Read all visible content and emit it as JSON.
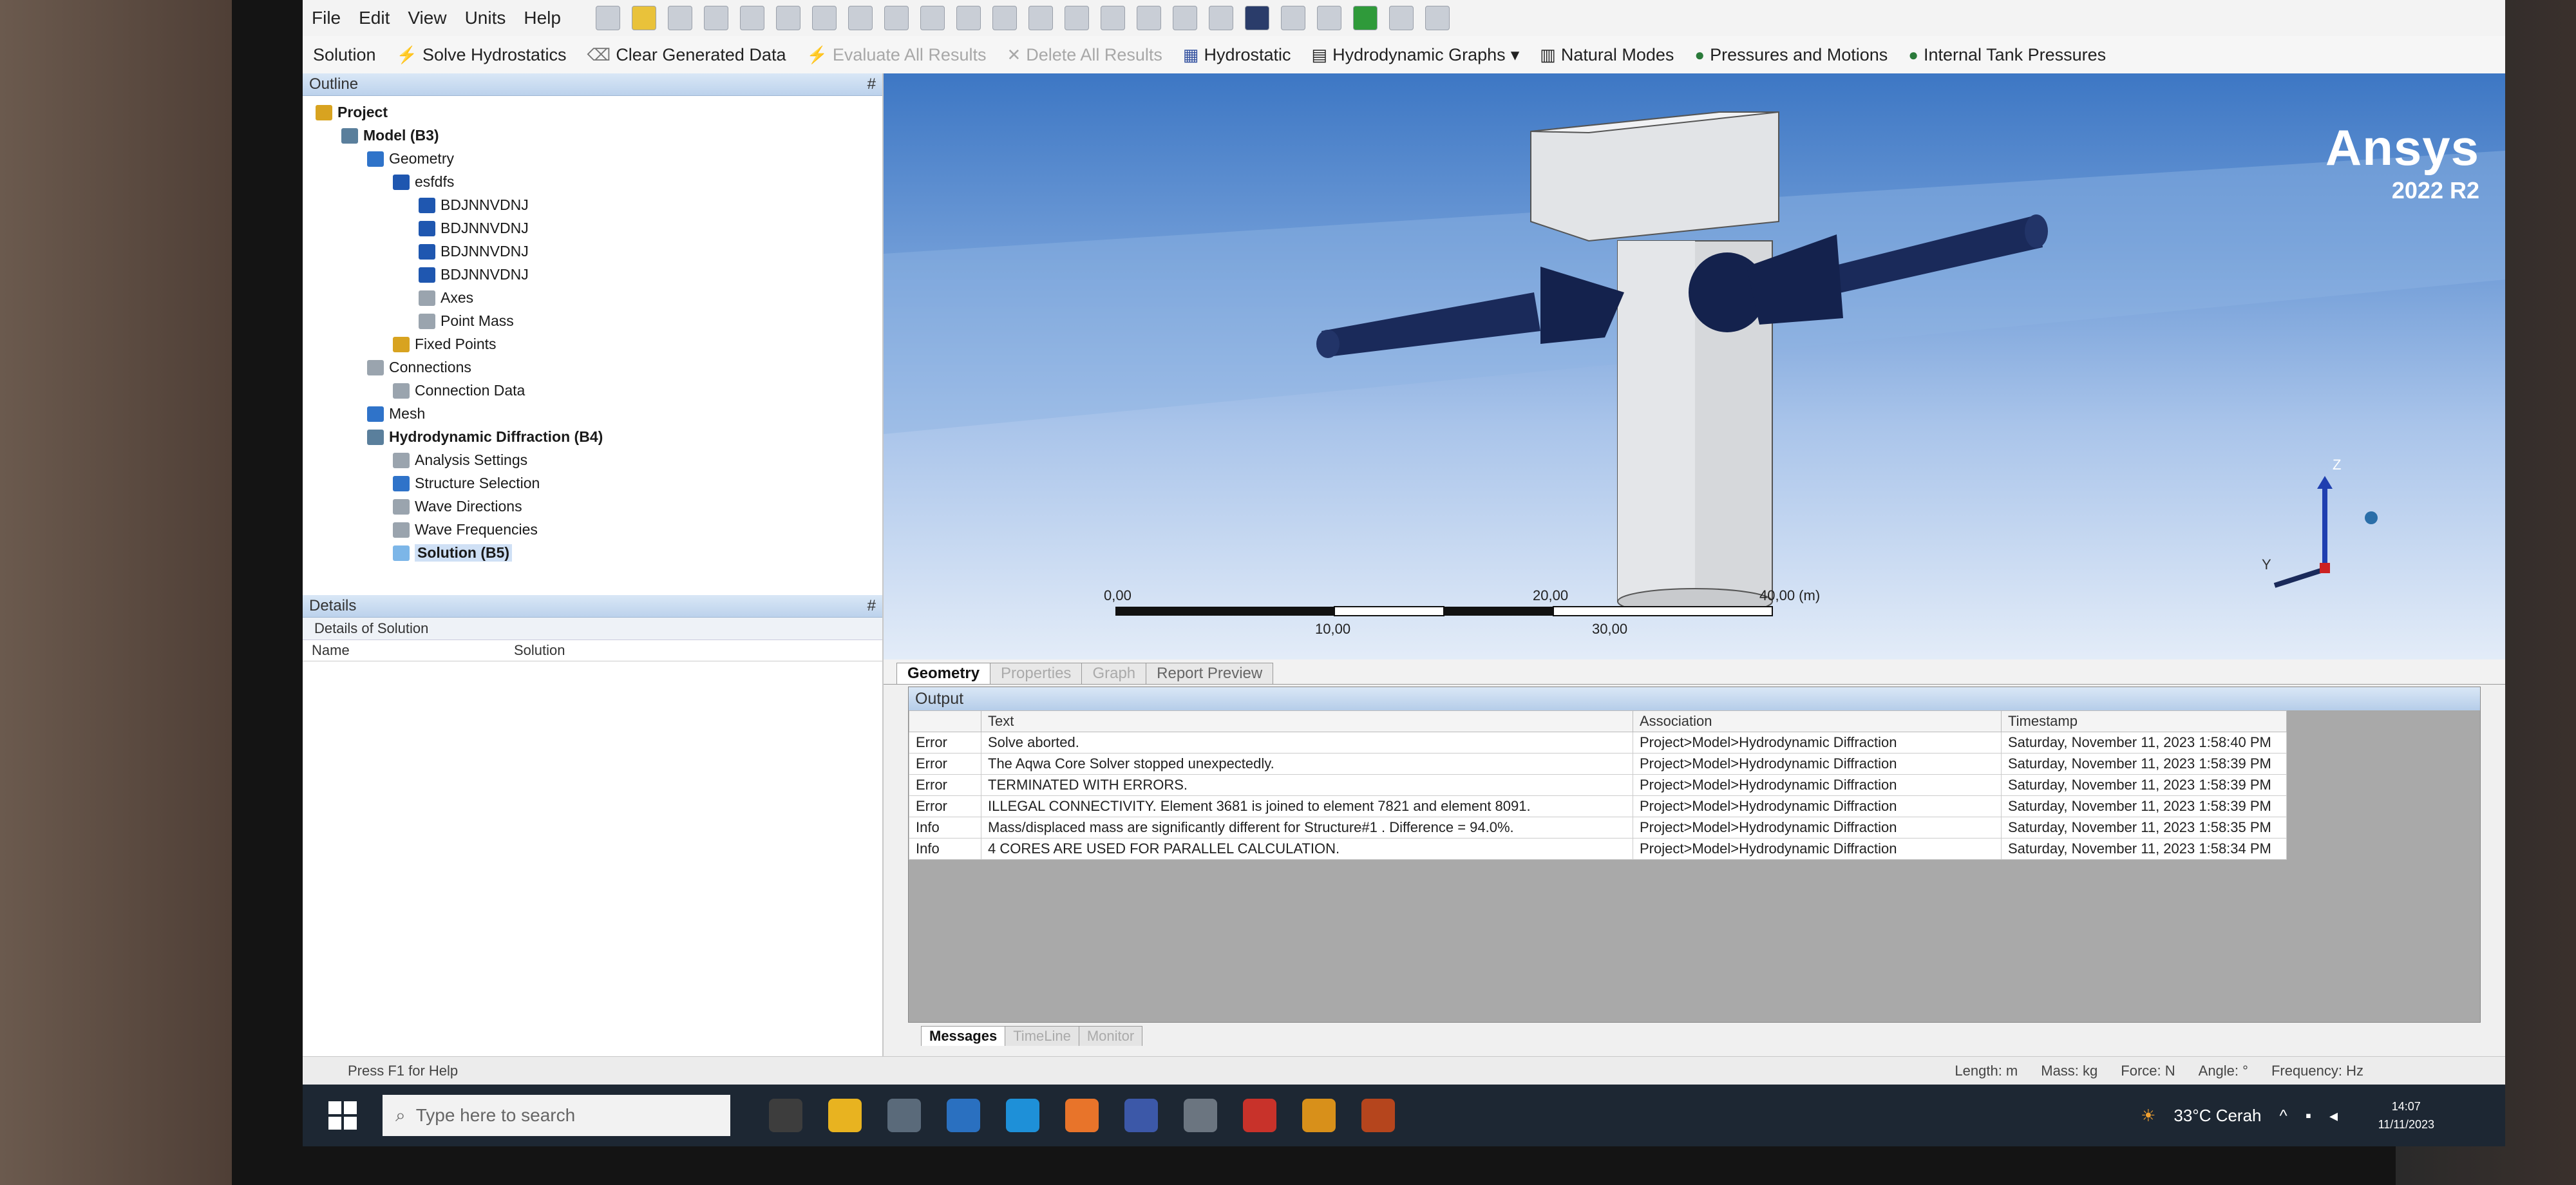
{
  "menu": [
    "File",
    "Edit",
    "View",
    "Units",
    "Help"
  ],
  "context_toolbar": {
    "solution": "Solution",
    "solve_hydrostatics": "Solve Hydrostatics",
    "clear_generated": "Clear Generated Data",
    "evaluate_all": "Evaluate All Results",
    "delete_all": "Delete All Results",
    "hydrostatic": "Hydrostatic",
    "hydro_graphs": "Hydrodynamic Graphs",
    "natural_modes": "Natural Modes",
    "pressures_motions": "Pressures and Motions",
    "internal_tank": "Internal Tank Pressures"
  },
  "outline": {
    "title": "Outline",
    "pin": "#",
    "tree": [
      {
        "label": "Project",
        "bold": true
      },
      {
        "label": "Model (B3)",
        "bold": true
      },
      {
        "label": "Geometry"
      },
      {
        "label": "esfdfs"
      },
      {
        "label": "BDJNNVDNJ"
      },
      {
        "label": "BDJNNVDNJ"
      },
      {
        "label": "BDJNNVDNJ"
      },
      {
        "label": "BDJNNVDNJ"
      },
      {
        "label": "Axes"
      },
      {
        "label": "Point Mass"
      },
      {
        "label": "Fixed Points"
      },
      {
        "label": "Connections"
      },
      {
        "label": "Connection Data"
      },
      {
        "label": "Mesh"
      },
      {
        "label": "Hydrodynamic Diffraction (B4)",
        "bold": true
      },
      {
        "label": "Analysis Settings"
      },
      {
        "label": "Structure Selection"
      },
      {
        "label": "Wave Directions"
      },
      {
        "label": "Wave Frequencies"
      },
      {
        "label": "Solution (B5)",
        "bold": true
      }
    ]
  },
  "details": {
    "title": "Details",
    "pin": "#",
    "subtitle": "Details of Solution",
    "name_col": "Name",
    "name_val": "Solution"
  },
  "viewport": {
    "brand": "Ansys",
    "version": "2022 R2",
    "axis_z": "Z",
    "axis_y": "Y",
    "scale": {
      "t0": "0,00",
      "t10": "10,00",
      "t20": "20,00",
      "t30": "30,00",
      "t40": "40,00 (m)"
    }
  },
  "geo_tabs": [
    "Geometry",
    "Properties",
    "Graph",
    "Report Preview"
  ],
  "output": {
    "title": "Output",
    "headers": [
      "",
      "Text",
      "Association",
      "Timestamp"
    ],
    "rows": [
      [
        "Error",
        "Solve aborted.",
        "Project>Model>Hydrodynamic Diffraction",
        "Saturday, November 11, 2023 1:58:40 PM"
      ],
      [
        "Error",
        "The Aqwa Core Solver stopped unexpectedly.",
        "Project>Model>Hydrodynamic Diffraction",
        "Saturday, November 11, 2023 1:58:39 PM"
      ],
      [
        "Error",
        "TERMINATED WITH ERRORS.",
        "Project>Model>Hydrodynamic Diffraction",
        "Saturday, November 11, 2023 1:58:39 PM"
      ],
      [
        "Error",
        "ILLEGAL CONNECTIVITY. Element 3681 is joined to element 7821 and element 8091.",
        "Project>Model>Hydrodynamic Diffraction",
        "Saturday, November 11, 2023 1:58:39 PM"
      ],
      [
        "Info",
        "Mass/displaced mass are significantly different for Structure#1 . Difference = 94.0%.",
        "Project>Model>Hydrodynamic Diffraction",
        "Saturday, November 11, 2023 1:58:35 PM"
      ],
      [
        "Info",
        "4 CORES ARE USED FOR PARALLEL CALCULATION.",
        "Project>Model>Hydrodynamic Diffraction",
        "Saturday, November 11, 2023 1:58:34 PM"
      ]
    ]
  },
  "msg_tabs": [
    "Messages",
    "TimeLine",
    "Monitor"
  ],
  "status": {
    "hint": "Press F1 for Help",
    "length": "Length: m",
    "mass": "Mass: kg",
    "force": "Force: N",
    "angle": "Angle: °",
    "freq": "Frequency: Hz"
  },
  "taskbar": {
    "search_placeholder": "Type here to search",
    "weather": "33°C Cerah",
    "time": "14:07",
    "date": "11/11/2023"
  }
}
